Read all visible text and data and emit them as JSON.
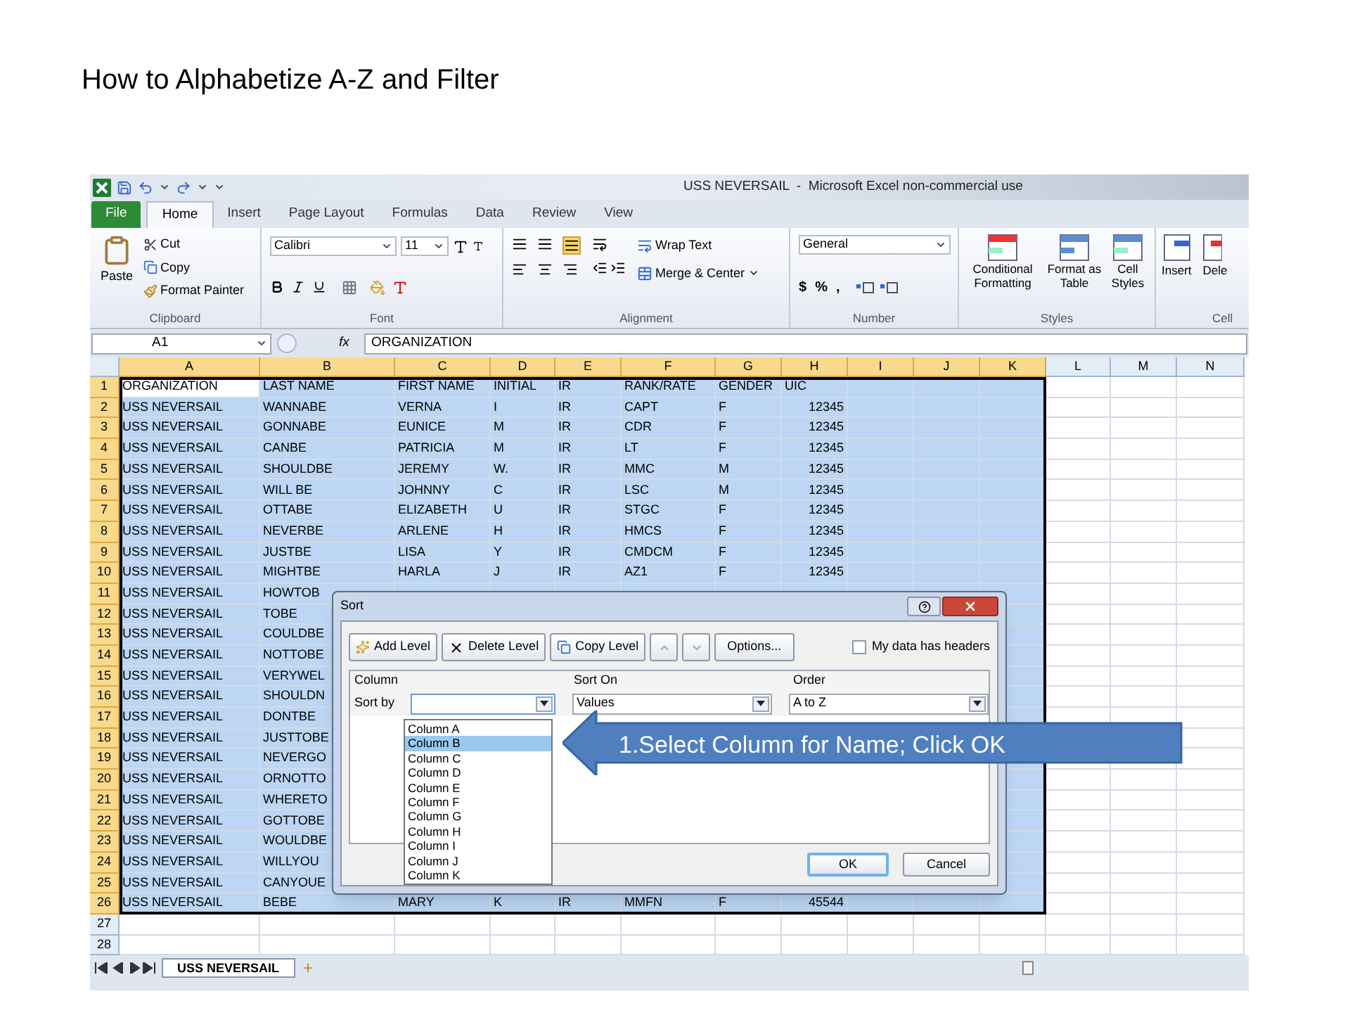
{
  "slide_title": "How to Alphabetize A-Z and Filter",
  "window": {
    "title": "USS NEVERSAIL  -  Microsoft Excel non-commercial use"
  },
  "tabs": [
    {
      "label": "File",
      "kind": "file",
      "selected": false
    },
    {
      "label": "Home",
      "kind": "tab",
      "selected": true
    },
    {
      "label": "Insert",
      "kind": "tab",
      "selected": false
    },
    {
      "label": "Page Layout",
      "kind": "tab",
      "selected": false
    },
    {
      "label": "Formulas",
      "kind": "tab",
      "selected": false
    },
    {
      "label": "Data",
      "kind": "tab",
      "selected": false
    },
    {
      "label": "Review",
      "kind": "tab",
      "selected": false
    },
    {
      "label": "View",
      "kind": "tab",
      "selected": false
    }
  ],
  "ribbon": {
    "clipboard": {
      "paste": "Paste",
      "cut": "Cut",
      "copy": "Copy",
      "format_painter": "Format Painter",
      "label": "Clipboard"
    },
    "font": {
      "font_name": "Calibri",
      "font_size": "11",
      "label": "Font"
    },
    "alignment": {
      "wrap_text": "Wrap Text",
      "merge_center": "Merge & Center",
      "label": "Alignment"
    },
    "number": {
      "format": "General",
      "symbols": [
        "$",
        "%",
        ","
      ],
      "label": "Number"
    },
    "styles": {
      "conditional_formatting": "Conditional Formatting",
      "format_as_table": "Format as Table",
      "cell_styles": "Cell Styles",
      "label": "Styles"
    },
    "cells": {
      "insert": "Insert",
      "delete": "Dele",
      "label": "Cell"
    }
  },
  "formula_bar": {
    "name_box": "A1",
    "fx": "fx",
    "formula": "ORGANIZATION"
  },
  "columns": [
    {
      "label": "A",
      "selected": true
    },
    {
      "label": "B",
      "selected": true
    },
    {
      "label": "C",
      "selected": true
    },
    {
      "label": "D",
      "selected": true
    },
    {
      "label": "E",
      "selected": true
    },
    {
      "label": "F",
      "selected": true
    },
    {
      "label": "G",
      "selected": true
    },
    {
      "label": "H",
      "selected": true,
      "numeric": true
    },
    {
      "label": "I",
      "selected": true
    },
    {
      "label": "J",
      "selected": true
    },
    {
      "label": "K",
      "selected": true
    },
    {
      "label": "L",
      "selected": false
    },
    {
      "label": "M",
      "selected": false
    },
    {
      "label": "N",
      "selected": false
    }
  ],
  "rows": [
    {
      "number": "1",
      "selected": true,
      "header": true,
      "cells": [
        {
          "text": "ORGANIZATION",
          "active": true
        },
        "LAST NAME",
        "FIRST NAME",
        "INITIAL",
        "IR",
        "RANK/RATE",
        "GENDER",
        "UIC"
      ]
    },
    {
      "number": "2",
      "selected": true,
      "cells": [
        "USS NEVERSAIL",
        "WANNABE",
        "VERNA",
        "I",
        "IR",
        "CAPT",
        "F",
        "12345"
      ]
    },
    {
      "number": "3",
      "selected": true,
      "cells": [
        "USS NEVERSAIL",
        "GONNABE",
        "EUNICE",
        "M",
        "IR",
        "CDR",
        "F",
        "12345"
      ]
    },
    {
      "number": "4",
      "selected": true,
      "cells": [
        "USS NEVERSAIL",
        "CANBE",
        "PATRICIA",
        "M",
        "IR",
        "LT",
        "F",
        "12345"
      ]
    },
    {
      "number": "5",
      "selected": true,
      "cells": [
        "USS NEVERSAIL",
        "SHOULDBE",
        "JEREMY",
        "W.",
        "IR",
        "MMC",
        "M",
        "12345"
      ]
    },
    {
      "number": "6",
      "selected": true,
      "cells": [
        "USS NEVERSAIL",
        "WILL BE",
        "JOHNNY",
        "C",
        "IR",
        "LSC",
        "M",
        "12345"
      ]
    },
    {
      "number": "7",
      "selected": true,
      "cells": [
        "USS NEVERSAIL",
        "OTTABE",
        "ELIZABETH",
        "U",
        "IR",
        "STGC",
        "F",
        "12345"
      ]
    },
    {
      "number": "8",
      "selected": true,
      "cells": [
        "USS NEVERSAIL",
        "NEVERBE",
        "ARLENE",
        "H",
        "IR",
        "HMCS",
        "F",
        "12345"
      ]
    },
    {
      "number": "9",
      "selected": true,
      "cells": [
        "USS NEVERSAIL",
        "JUSTBE",
        "LISA",
        "Y",
        "IR",
        "CMDCM",
        "F",
        "12345"
      ]
    },
    {
      "number": "10",
      "selected": true,
      "cells": [
        "USS NEVERSAIL",
        "MIGHTBE",
        "HARLA",
        "J",
        "IR",
        "AZ1",
        "F",
        "12345"
      ]
    },
    {
      "number": "11",
      "selected": true,
      "cells": [
        "USS NEVERSAIL",
        "HOWTOB"
      ]
    },
    {
      "number": "12",
      "selected": true,
      "cells": [
        "USS NEVERSAIL",
        "TOBE"
      ]
    },
    {
      "number": "13",
      "selected": true,
      "cells": [
        "USS NEVERSAIL",
        "COULDBE"
      ]
    },
    {
      "number": "14",
      "selected": true,
      "cells": [
        "USS NEVERSAIL",
        "NOTTOBE"
      ]
    },
    {
      "number": "15",
      "selected": true,
      "cells": [
        "USS NEVERSAIL",
        "VERYWEL"
      ]
    },
    {
      "number": "16",
      "selected": true,
      "cells": [
        "USS NEVERSAIL",
        "SHOULDN"
      ]
    },
    {
      "number": "17",
      "selected": true,
      "cells": [
        "USS NEVERSAIL",
        "DONTBE"
      ]
    },
    {
      "number": "18",
      "selected": true,
      "cells": [
        "USS NEVERSAIL",
        "JUSTTOBE"
      ]
    },
    {
      "number": "19",
      "selected": true,
      "cells": [
        "USS NEVERSAIL",
        "NEVERGO"
      ]
    },
    {
      "number": "20",
      "selected": true,
      "cells": [
        "USS NEVERSAIL",
        "ORNOTTO"
      ]
    },
    {
      "number": "21",
      "selected": true,
      "cells": [
        "USS NEVERSAIL",
        "WHERETO"
      ]
    },
    {
      "number": "22",
      "selected": true,
      "cells": [
        "USS NEVERSAIL",
        "GOTTOBE"
      ]
    },
    {
      "number": "23",
      "selected": true,
      "cells": [
        "USS NEVERSAIL",
        "WOULDBE"
      ]
    },
    {
      "number": "24",
      "selected": true,
      "cells": [
        "USS NEVERSAIL",
        "WILLYOU"
      ]
    },
    {
      "number": "25",
      "selected": true,
      "cells": [
        "USS NEVERSAIL",
        "CANYOUE"
      ]
    },
    {
      "number": "26",
      "selected": true,
      "cells": [
        "USS NEVERSAIL",
        "BEBE",
        "MARY",
        "K",
        "IR",
        "MMFN",
        "F",
        "45544"
      ]
    },
    {
      "number": "27",
      "selected": false,
      "cells": []
    },
    {
      "number": "28",
      "selected": false,
      "cells": []
    }
  ],
  "sheet_tabs": [
    {
      "label": "USS NEVERSAIL",
      "selected": true
    }
  ],
  "dialog": {
    "title": "Sort",
    "toolbar": [
      {
        "label": "Add Level",
        "kind": "add"
      },
      {
        "label": "Delete Level",
        "kind": "delete"
      },
      {
        "label": "Copy Level",
        "kind": "copy"
      },
      {
        "kind": "up",
        "disabled": true
      },
      {
        "kind": "down",
        "disabled": true
      },
      {
        "label": "Options...",
        "kind": "plain"
      }
    ],
    "headers_checkbox": {
      "label": "My data has headers",
      "checked": false
    },
    "headings": [
      "Column",
      "Sort On",
      "Order"
    ],
    "level": {
      "label": "Sort by",
      "sort_on": "Values",
      "order": "A to Z"
    },
    "column_options": [
      {
        "label": "Column A",
        "selected": false
      },
      {
        "label": "Column B",
        "selected": true
      },
      {
        "label": "Column C",
        "selected": false
      },
      {
        "label": "Column D",
        "selected": false
      },
      {
        "label": "Column E",
        "selected": false
      },
      {
        "label": "Column F",
        "selected": false
      },
      {
        "label": "Column G",
        "selected": false
      },
      {
        "label": "Column H",
        "selected": false
      },
      {
        "label": "Column I",
        "selected": false
      },
      {
        "label": "Column J",
        "selected": false
      },
      {
        "label": "Column K",
        "selected": false
      }
    ],
    "ok": "OK",
    "cancel": "Cancel"
  },
  "callout": {
    "text": "1.Select Column for Name; Click OK"
  }
}
